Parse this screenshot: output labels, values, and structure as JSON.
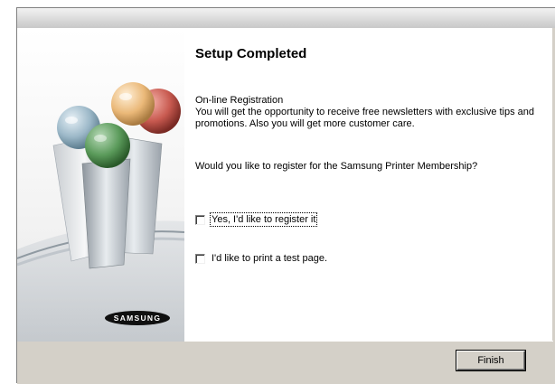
{
  "dialog": {
    "heading": "Setup Completed",
    "registration_title": "On-line Registration",
    "registration_body": "You will get the opportunity to receive free newsletters with exclusive tips and promotions. Also you will get more customer care.",
    "question": "Would you like to register for the Samsung Printer Membership?"
  },
  "options": [
    {
      "label": "Yes, I'd like to register it",
      "checked": false,
      "focused": true
    },
    {
      "label": "I'd like to print a test page.",
      "checked": false,
      "focused": false
    }
  ],
  "logo": {
    "text": "SAMSUNG"
  },
  "buttons": {
    "finish_label": "Finish"
  }
}
